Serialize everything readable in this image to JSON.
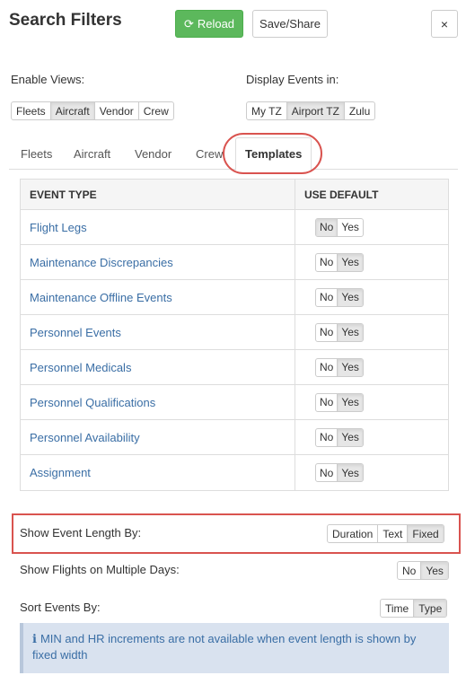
{
  "header": {
    "title": "Search Filters",
    "reload_label": "Reload",
    "save_label": "Save/Share",
    "close_label": "×"
  },
  "enable_views": {
    "label": "Enable Views:",
    "options": [
      "Fleets",
      "Aircraft",
      "Vendor",
      "Crew"
    ],
    "selected": "Aircraft"
  },
  "display_events": {
    "label": "Display Events in:",
    "options": [
      "My TZ",
      "Airport TZ",
      "Zulu"
    ],
    "selected": "Airport TZ"
  },
  "tabs": [
    {
      "label": "Fleets"
    },
    {
      "label": "Aircraft"
    },
    {
      "label": "Vendor"
    },
    {
      "label": "Crew"
    },
    {
      "label": "Templates"
    }
  ],
  "active_tab": "Templates",
  "table": {
    "headers": {
      "event_type": "EVENT TYPE",
      "use_default": "USE DEFAULT"
    },
    "rows": [
      {
        "event": "Flight Legs",
        "no": "No",
        "yes": "Yes",
        "selected": "No"
      },
      {
        "event": "Maintenance Discrepancies",
        "no": "No",
        "yes": "Yes",
        "selected": "Yes"
      },
      {
        "event": "Maintenance Offline Events",
        "no": "No",
        "yes": "Yes",
        "selected": "Yes"
      },
      {
        "event": "Personnel Events",
        "no": "No",
        "yes": "Yes",
        "selected": "Yes"
      },
      {
        "event": "Personnel Medicals",
        "no": "No",
        "yes": "Yes",
        "selected": "Yes"
      },
      {
        "event": "Personnel Qualifications",
        "no": "No",
        "yes": "Yes",
        "selected": "Yes"
      },
      {
        "event": "Personnel Availability",
        "no": "No",
        "yes": "Yes",
        "selected": "Yes"
      },
      {
        "event": "Assignment",
        "no": "No",
        "yes": "Yes",
        "selected": "Yes"
      }
    ]
  },
  "event_length": {
    "label": "Show Event Length By:",
    "options": [
      "Duration",
      "Text",
      "Fixed"
    ],
    "selected": "Fixed"
  },
  "multi_day": {
    "label": "Show Flights on Multiple Days:",
    "options": [
      "No",
      "Yes"
    ],
    "selected": "Yes"
  },
  "sort_events": {
    "label": "Sort Events By:",
    "options": [
      "Time",
      "Type"
    ],
    "selected": "Type"
  },
  "info": {
    "icon": "info-icon",
    "text": "MIN and HR increments are not available when event length is shown by fixed width"
  },
  "colors": {
    "accent_green": "#5cb85c",
    "link_blue": "#3a6ea5",
    "highlight_red": "#d9534f",
    "info_bg": "#d9e2ef"
  }
}
